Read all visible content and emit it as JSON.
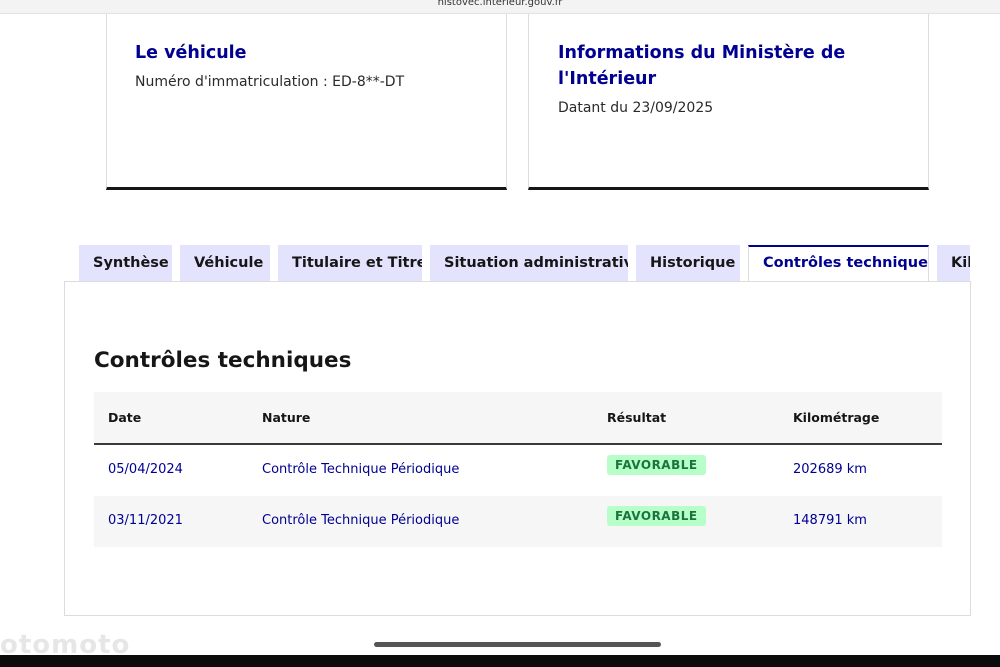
{
  "browser": {
    "url": "histovec.interieur.gouv.fr"
  },
  "cards": {
    "vehicle": {
      "title": "Le véhicule",
      "description": "Numéro d'immatriculation : ED-8**-DT"
    },
    "ministry": {
      "title_line1": "Informations du Ministère de",
      "title_line2": "l'Intérieur",
      "description": "Datant du 23/09/2025"
    }
  },
  "tabs": [
    {
      "label": "Synthèse"
    },
    {
      "label": "Véhicule"
    },
    {
      "label": "Titulaire et Titre"
    },
    {
      "label": "Situation administrative"
    },
    {
      "label": "Historique"
    },
    {
      "label": "Contrôles techniques"
    },
    {
      "label": "Kilométrage"
    }
  ],
  "section": {
    "title": "Contrôles techniques",
    "columns": [
      "Date",
      "Nature",
      "Résultat",
      "Kilométrage"
    ],
    "rows": [
      {
        "date": "05/04/2024",
        "nature": "Contrôle Technique Périodique",
        "result": "FAVORABLE",
        "km": "202689 km"
      },
      {
        "date": "03/11/2021",
        "nature": "Contrôle Technique Périodique",
        "result": "FAVORABLE",
        "km": "148791 km"
      }
    ]
  },
  "watermark": "otomoto",
  "colors": {
    "brand_blue": "#000091",
    "tab_bg": "#e3e3fd",
    "badge_bg": "#b8fec9",
    "badge_text": "#18753c"
  }
}
